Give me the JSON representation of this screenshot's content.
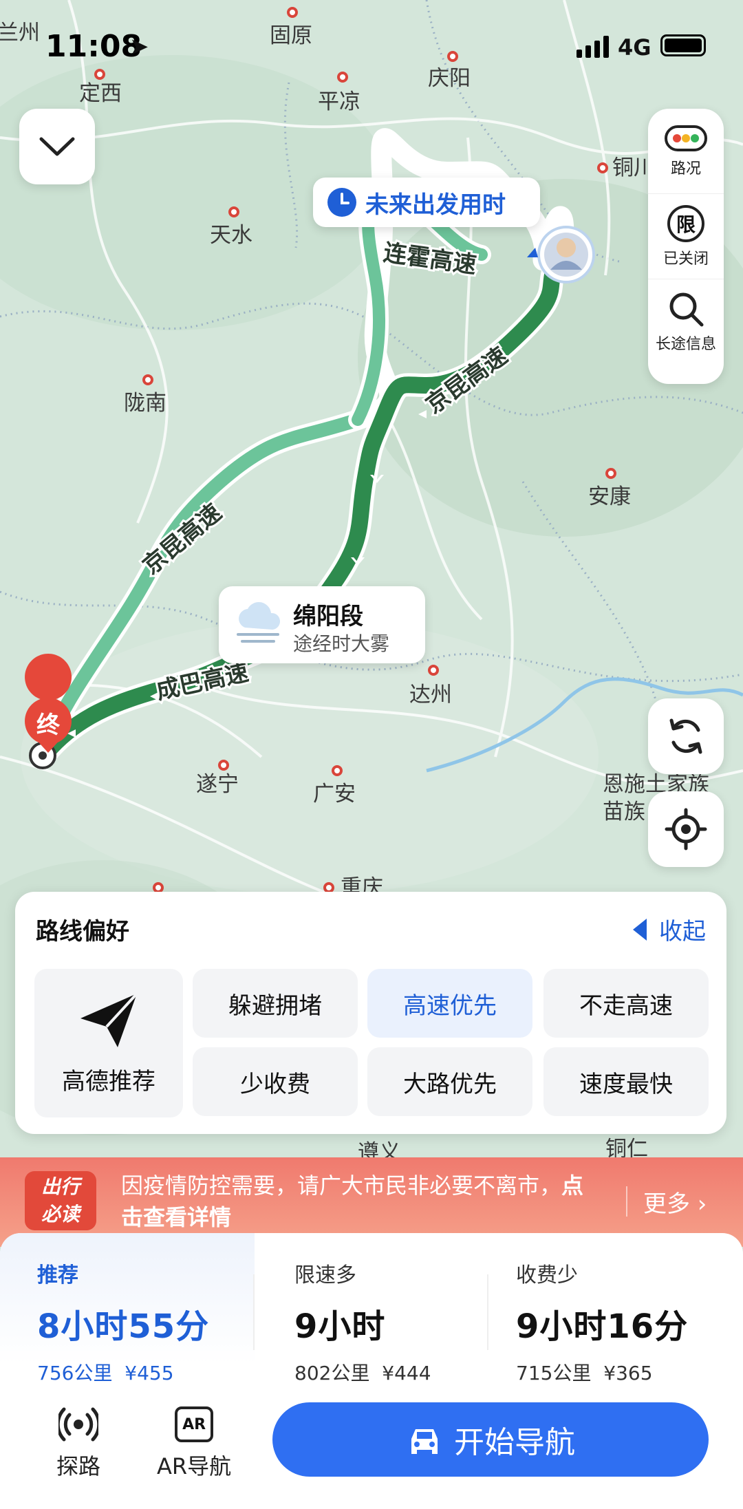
{
  "status_bar": {
    "time": "11:08",
    "network": "4G"
  },
  "map": {
    "cities": [
      {
        "name": "兰州"
      },
      {
        "name": "定西"
      },
      {
        "name": "固原"
      },
      {
        "name": "平凉"
      },
      {
        "name": "庆阳"
      },
      {
        "name": "铜川"
      },
      {
        "name": "天水"
      },
      {
        "name": "陇南"
      },
      {
        "name": "安康"
      },
      {
        "name": "达州"
      },
      {
        "name": "遂宁"
      },
      {
        "name": "广安"
      },
      {
        "name": "重庆"
      },
      {
        "name": "遵义"
      },
      {
        "name": "铜仁"
      },
      {
        "name": "恩施土家族"
      },
      {
        "name": "苗族"
      }
    ],
    "roads": [
      "连霍高速",
      "京昆高速",
      "京昆高速",
      "成巴高速"
    ],
    "depart_bubble": "未来出发用时",
    "weather": {
      "title": "绵阳段",
      "subtitle": "途经时大雾"
    },
    "destination_marker": "终"
  },
  "right_controls": [
    {
      "icon": "traffic-light-icon",
      "label": "路况"
    },
    {
      "icon": "restriction-icon",
      "label": "已关闭",
      "glyph": "限"
    },
    {
      "icon": "search-icon",
      "label": "长途信息"
    }
  ],
  "route_preference": {
    "title": "路线偏好",
    "collapse": "收起",
    "recommended": "高德推荐",
    "options": [
      {
        "label": "躲避拥堵",
        "active": false
      },
      {
        "label": "高速优先",
        "active": true
      },
      {
        "label": "不走高速",
        "active": false
      },
      {
        "label": "少收费",
        "active": false
      },
      {
        "label": "大路优先",
        "active": false
      },
      {
        "label": "速度最快",
        "active": false
      }
    ]
  },
  "notice": {
    "badge_line1": "出行",
    "badge_line2": "必读",
    "text_plain": "因疫情防控需要，请广大市民非必要不离市，",
    "text_bold": "点击查看详情",
    "more": "更多 ›"
  },
  "routes": [
    {
      "tag": "推荐",
      "duration": "8小时55分",
      "distance": "756公里",
      "cost": "¥455"
    },
    {
      "tag": "限速多",
      "duration": "9小时",
      "distance": "802公里",
      "cost": "¥444"
    },
    {
      "tag": "收费少",
      "duration": "9小时16分",
      "distance": "715公里",
      "cost": "¥365"
    }
  ],
  "tools": [
    {
      "icon": "explore-road-icon",
      "label": "探路"
    },
    {
      "icon": "ar-icon",
      "label": "AR导航",
      "glyph": "AR"
    }
  ],
  "start_button": "开始导航",
  "colors": {
    "accent": "#2f6ff2",
    "route_main": "#2e8b4e",
    "route_alt": "#6cc49a",
    "notice": "#f07a6e"
  }
}
